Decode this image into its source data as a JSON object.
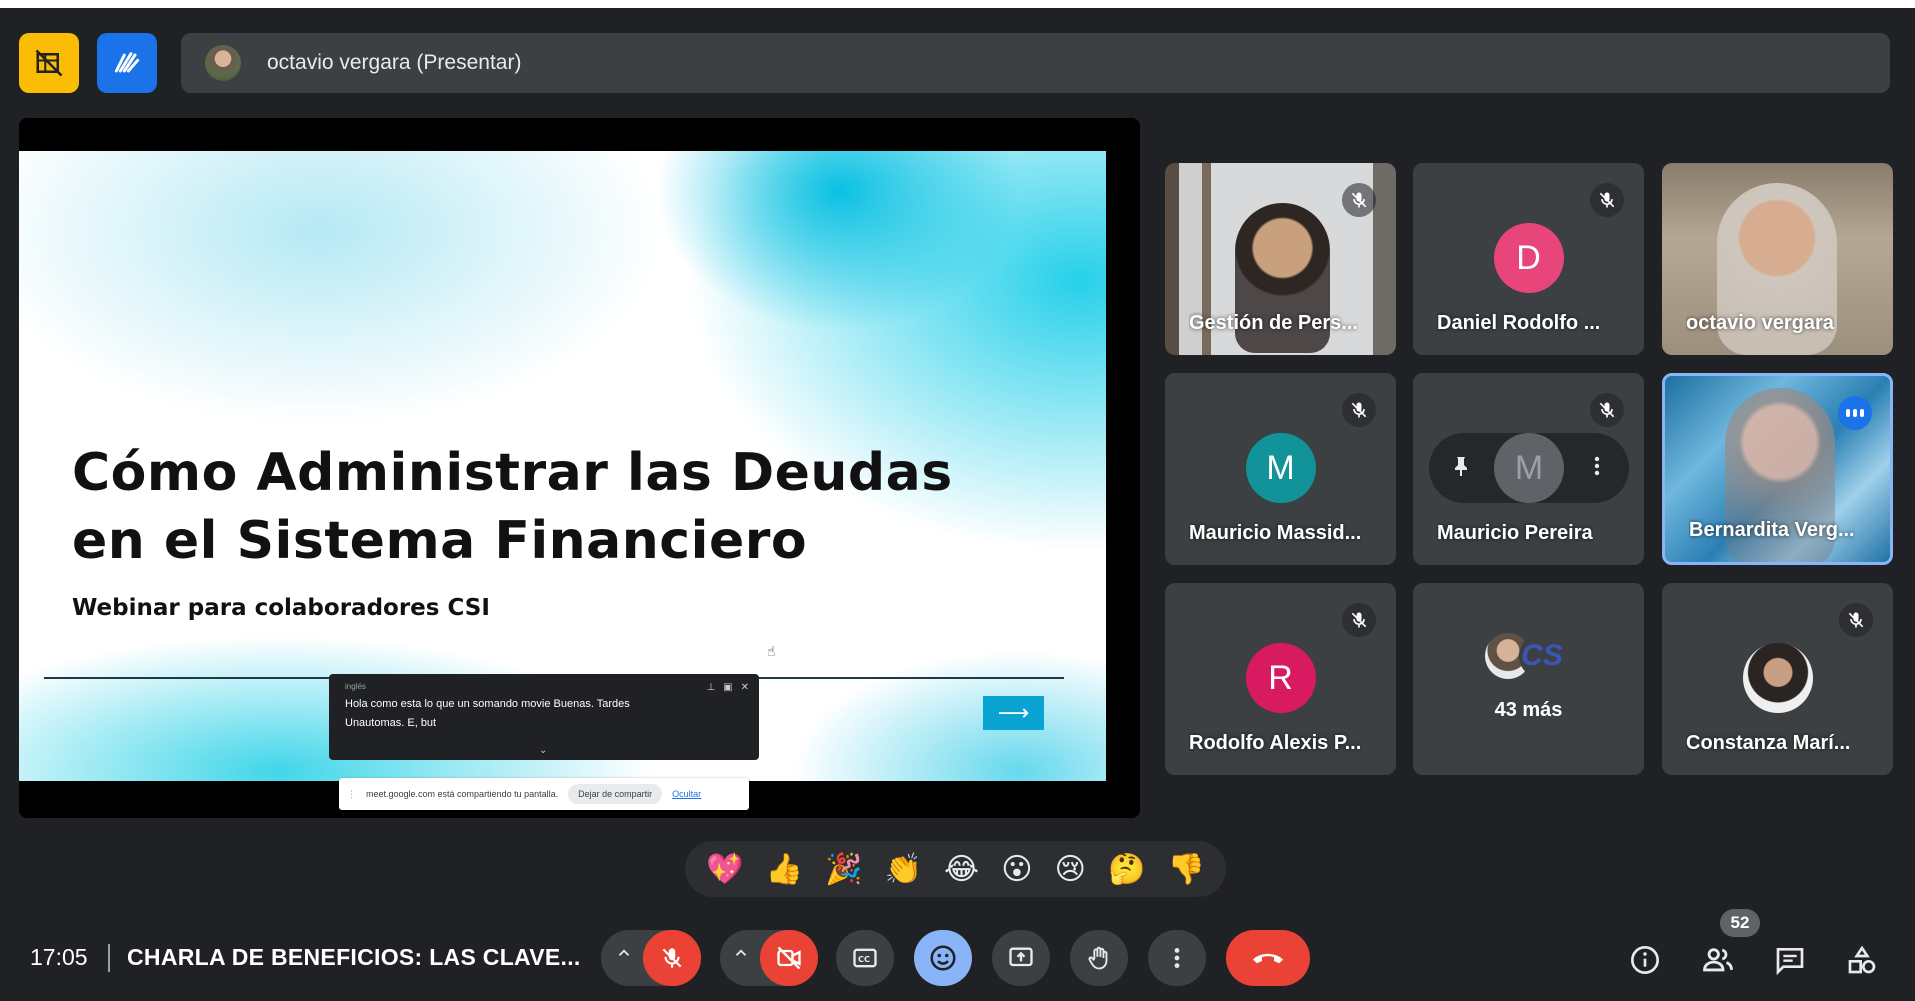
{
  "header": {
    "presenter_label": "octavio vergara (Presentar)"
  },
  "slide": {
    "title_line1": "Cómo Administrar las Deudas",
    "title_line2": "en el Sistema Financiero",
    "subtitle": "Webinar para colaboradores CSI",
    "arrow": "⟶"
  },
  "captions": {
    "language": "inglés",
    "text": "Hola como esta lo que un somando movie Buenas. Tardes Unautomas. E, but"
  },
  "share_bar": {
    "message": "meet.google.com está compartiendo tu pantalla.",
    "stop_label": "Dejar de compartir",
    "hide_label": "Ocultar"
  },
  "participants": [
    {
      "name": "Gestión de Pers..."
    },
    {
      "name": "Daniel Rodolfo ...",
      "initial": "D",
      "color": "#e8457a"
    },
    {
      "name": "octavio vergara"
    },
    {
      "name": "Mauricio Massid...",
      "initial": "M",
      "color": "#12939a"
    },
    {
      "name": "Mauricio Pereira",
      "initial": "M"
    },
    {
      "name": "Bernardita Verg..."
    },
    {
      "name": "Rodolfo Alexis P...",
      "initial": "R",
      "color": "#d81b60"
    },
    {
      "name": "43 más",
      "mini_logo": "CS"
    },
    {
      "name": "Constanza Marí..."
    }
  ],
  "reactions": [
    "💖",
    "👍",
    "🎉",
    "👏",
    "😂",
    "😮",
    "😢",
    "🤔",
    "👎"
  ],
  "footer": {
    "time": "17:05",
    "meeting_title": "CHARLA DE BENEFICIOS: LAS CLAVE...",
    "people_count": "52"
  },
  "colors": {
    "background": "#202124",
    "tile": "#3c4043",
    "danger": "#ea4335",
    "accent": "#8ab4f8",
    "brand_blue": "#1a73e8",
    "brand_yellow": "#fbbc04"
  },
  "icons": {
    "yellow_button": "no-video-grid-icon",
    "blue_button": "pen-doodle-icon",
    "mic": "mic-off-icon",
    "camera": "camera-off-icon",
    "captions": "closed-captions-icon",
    "emoji": "emoji-icon",
    "present": "present-screen-icon",
    "hand": "raise-hand-icon",
    "more": "more-vert-icon",
    "leave": "hang-up-icon",
    "info": "info-icon",
    "people": "people-icon",
    "chat": "chat-icon",
    "activities": "activities-icon"
  }
}
